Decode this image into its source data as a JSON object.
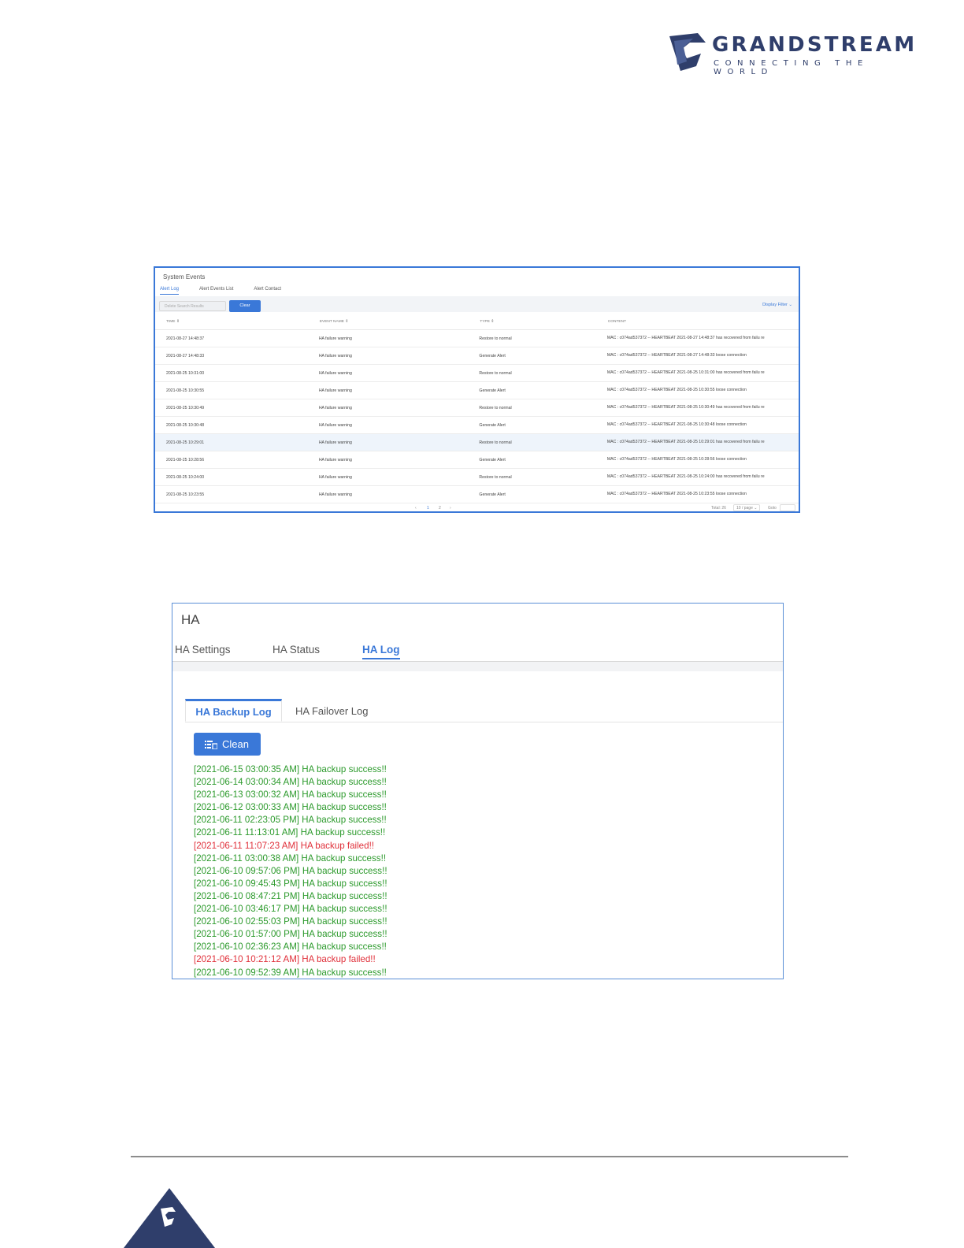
{
  "brand": {
    "name": "GRANDSTREAM",
    "tagline": "CONNECTING THE WORLD",
    "color": "#2f3e6b"
  },
  "system_events": {
    "title": "System Events",
    "tabs": [
      "Alert Log",
      "Alert Events List",
      "Alert Contact"
    ],
    "active_tab": "Alert Log",
    "delete_button": "Delete Search Results",
    "clear_button": "Clear",
    "display_filter": "Display Filter",
    "columns": [
      "TIME",
      "EVENT NAME",
      "TYPE",
      "CONTENT"
    ],
    "rows": [
      {
        "time": "2021-08-27 14:48:37",
        "event": "HA failure warning",
        "type": "Restore to normal",
        "content": "MAC : c074ad537372 -- HEARTBEAT 2021-08-27 14:48:37 has recovered from failu re"
      },
      {
        "time": "2021-08-27 14:48:33",
        "event": "HA failure warning",
        "type": "Generate Alert",
        "content": "MAC : c074ad537372 -- HEARTBEAT 2021-08-27 14:48:33 loose connection"
      },
      {
        "time": "2021-08-25 10:31:00",
        "event": "HA failure warning",
        "type": "Restore to normal",
        "content": "MAC : c074ad537372 -- HEARTBEAT 2021-08-25 10:31:00 has recovered from failu re"
      },
      {
        "time": "2021-08-25 10:30:55",
        "event": "HA failure warning",
        "type": "Generate Alert",
        "content": "MAC : c074ad537372 -- HEARTBEAT 2021-08-25 10:30:55 loose connection"
      },
      {
        "time": "2021-08-25 10:30:49",
        "event": "HA failure warning",
        "type": "Restore to normal",
        "content": "MAC : c074ad537372 -- HEARTBEAT 2021-08-25 10:30:49 has recovered from failu re"
      },
      {
        "time": "2021-08-25 10:30:48",
        "event": "HA failure warning",
        "type": "Generate Alert",
        "content": "MAC : c074ad537372 -- HEARTBEAT 2021-08-25 10:30:48 loose connection"
      },
      {
        "time": "2021-08-25 10:29:01",
        "event": "HA failure warning",
        "type": "Restore to normal",
        "content": "MAC : c074ad537372 -- HEARTBEAT 2021-08-25 10:29:01 has recovered from failu re"
      },
      {
        "time": "2021-08-25 10:28:56",
        "event": "HA failure warning",
        "type": "Generate Alert",
        "content": "MAC : c074ad537372 -- HEARTBEAT 2021-08-25 10:28:56 loose connection"
      },
      {
        "time": "2021-08-25 10:24:00",
        "event": "HA failure warning",
        "type": "Restore to normal",
        "content": "MAC : c074ad537372 -- HEARTBEAT 2021-08-25 10:24:00 has recovered from failu re"
      },
      {
        "time": "2021-08-25 10:23:55",
        "event": "HA failure warning",
        "type": "Generate Alert",
        "content": "MAC : c074ad537372 -- HEARTBEAT 2021-08-25 10:23:55 loose connection"
      }
    ],
    "pager": {
      "pages": [
        "1",
        "2"
      ],
      "current_page": "1",
      "total": "Total: 26",
      "page_size": "10 / page",
      "goto_label": "Goto"
    }
  },
  "ha": {
    "title": "HA",
    "tabs": [
      "HA Settings",
      "HA Status",
      "HA Log"
    ],
    "active_tab": "HA Log",
    "sub_tabs": [
      "HA Backup Log",
      "HA Failover Log"
    ],
    "active_sub_tab": "HA Backup Log",
    "clean_button": "Clean",
    "log_lines": [
      {
        "text": "[2021-06-15 03:00:35 AM] HA backup success!!",
        "status": "success"
      },
      {
        "text": "[2021-06-14 03:00:34 AM] HA backup success!!",
        "status": "success"
      },
      {
        "text": "[2021-06-13 03:00:32 AM] HA backup success!!",
        "status": "success"
      },
      {
        "text": "[2021-06-12 03:00:33 AM] HA backup success!!",
        "status": "success"
      },
      {
        "text": "[2021-06-11 02:23:05 PM] HA backup success!!",
        "status": "success"
      },
      {
        "text": "[2021-06-11 11:13:01 AM] HA backup success!!",
        "status": "success"
      },
      {
        "text": "[2021-06-11 11:07:23 AM] HA backup failed!!",
        "status": "failed"
      },
      {
        "text": "[2021-06-11 03:00:38 AM] HA backup success!!",
        "status": "success"
      },
      {
        "text": "[2021-06-10 09:57:06 PM] HA backup success!!",
        "status": "success"
      },
      {
        "text": "[2021-06-10 09:45:43 PM] HA backup success!!",
        "status": "success"
      },
      {
        "text": "[2021-06-10 08:47:21 PM] HA backup success!!",
        "status": "success"
      },
      {
        "text": "[2021-06-10 03:46:17 PM] HA backup success!!",
        "status": "success"
      },
      {
        "text": "[2021-06-10 02:55:03 PM] HA backup success!!",
        "status": "success"
      },
      {
        "text": "[2021-06-10 01:57:00 PM] HA backup success!!",
        "status": "success"
      },
      {
        "text": "[2021-06-10 02:36:23 AM] HA backup success!!",
        "status": "success"
      },
      {
        "text": "[2021-06-10 10:21:12 AM] HA backup failed!!",
        "status": "failed"
      },
      {
        "text": "[2021-06-10 09:52:39 AM] HA backup success!!",
        "status": "success"
      }
    ],
    "colors": {
      "accent": "#3a78d8",
      "success": "#2c9a2c",
      "failed": "#e0303a"
    }
  }
}
